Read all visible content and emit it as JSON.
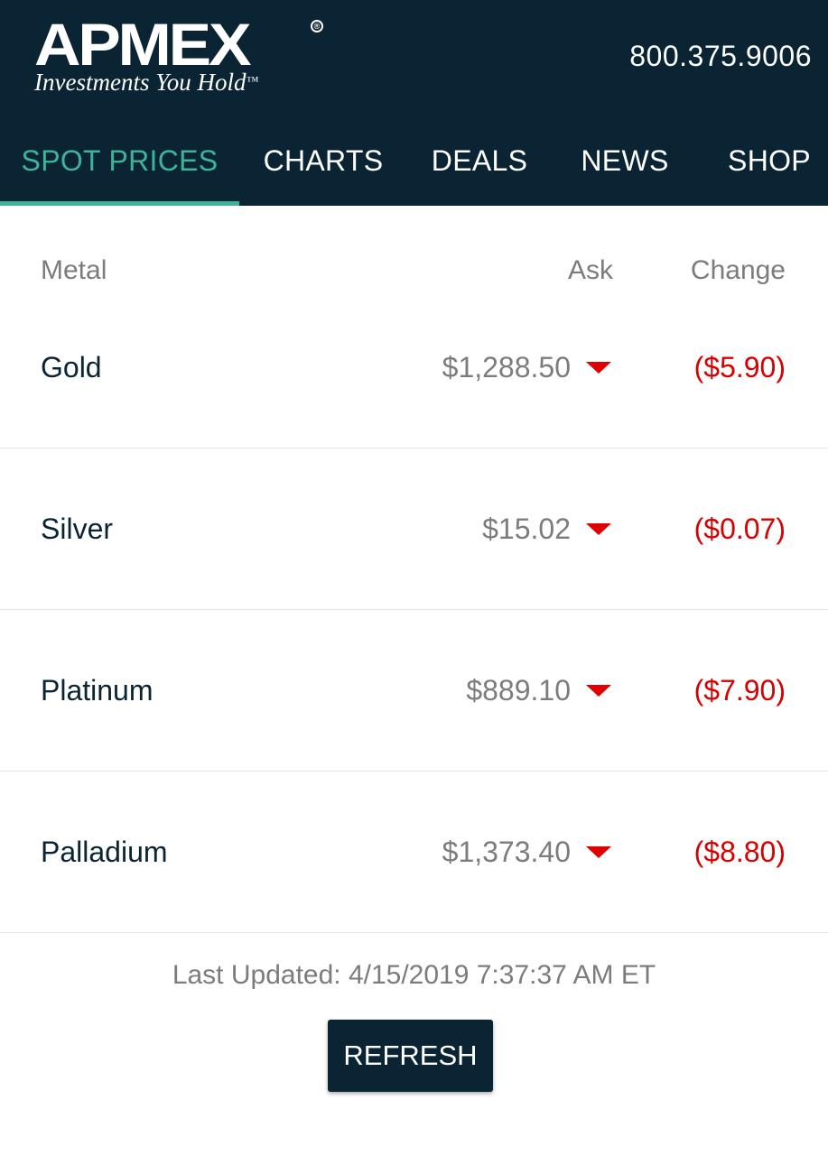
{
  "header": {
    "logo_text": "APMEX",
    "logo_registered": "®",
    "tagline": "Investments You Hold",
    "tagline_tm": "™",
    "phone": "800.375.9006"
  },
  "nav": {
    "tabs": [
      {
        "label": "SPOT PRICES",
        "active": true
      },
      {
        "label": "CHARTS",
        "active": false
      },
      {
        "label": "DEALS",
        "active": false
      },
      {
        "label": "NEWS",
        "active": false
      },
      {
        "label": "SHOP",
        "active": false
      }
    ]
  },
  "table": {
    "headers": {
      "metal": "Metal",
      "ask": "Ask",
      "change": "Change"
    },
    "rows": [
      {
        "metal": "Gold",
        "ask": "$1,288.50",
        "direction": "down",
        "change": "($5.90)"
      },
      {
        "metal": "Silver",
        "ask": "$15.02",
        "direction": "down",
        "change": "($0.07)"
      },
      {
        "metal": "Platinum",
        "ask": "$889.10",
        "direction": "down",
        "change": "($7.90)"
      },
      {
        "metal": "Palladium",
        "ask": "$1,373.40",
        "direction": "down",
        "change": "($8.80)"
      }
    ]
  },
  "footer": {
    "last_updated": "Last Updated: 4/15/2019 7:37:37 AM ET",
    "refresh_label": "REFRESH"
  },
  "colors": {
    "header_bg": "#0b2434",
    "accent": "#3db39a",
    "negative": "#d80000"
  }
}
